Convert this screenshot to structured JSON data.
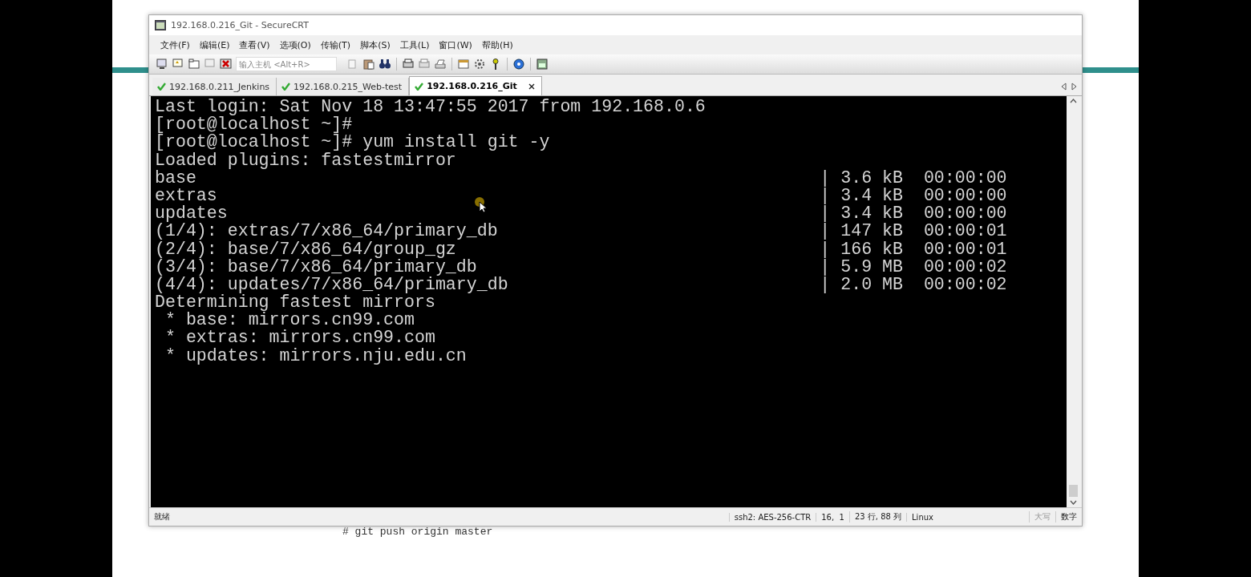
{
  "window": {
    "title": "192.168.0.216_Git - SecureCRT"
  },
  "menu": [
    "文件(F)",
    "编辑(E)",
    "查看(V)",
    "选项(O)",
    "传输(T)",
    "脚本(S)",
    "工具(L)",
    "窗口(W)",
    "帮助(H)"
  ],
  "toolbar": {
    "host_field": {
      "placeholder": "输入主机 <Alt+R>"
    }
  },
  "tabs": [
    {
      "label": "192.168.0.211_Jenkins",
      "selected": false,
      "connected": true
    },
    {
      "label": "192.168.0.215_Web-test",
      "selected": false,
      "connected": true
    },
    {
      "label": "192.168.0.216_Git",
      "selected": true,
      "connected": true
    }
  ],
  "terminal": {
    "lines": [
      {
        "text": "Last login: Sat Nov 18 13:47:55 2017 from 192.168.0.6"
      },
      {
        "text": "[root@localhost ~]#"
      },
      {
        "text": "[root@localhost ~]# yum install git -y"
      },
      {
        "text": "Loaded plugins: fastestmirror"
      },
      {
        "text": "base",
        "progress": "| 3.6 kB  00:00:00"
      },
      {
        "text": "extras",
        "progress": "| 3.4 kB  00:00:00"
      },
      {
        "text": "updates",
        "progress": "| 3.4 kB  00:00:00"
      },
      {
        "text": "(1/4): extras/7/x86_64/primary_db",
        "progress": "| 147 kB  00:00:01"
      },
      {
        "text": "(2/4): base/7/x86_64/group_gz",
        "progress": "| 166 kB  00:00:01"
      },
      {
        "text": "(3/4): base/7/x86_64/primary_db",
        "progress": "| 5.9 MB  00:00:02"
      },
      {
        "text": "(4/4): updates/7/x86_64/primary_db",
        "progress": "| 2.0 MB  00:00:02"
      },
      {
        "text": "Determining fastest mirrors"
      },
      {
        "text": " * base: mirrors.cn99.com"
      },
      {
        "text": " * extras: mirrors.cn99.com"
      },
      {
        "text": " * updates: mirrors.nju.edu.cn"
      }
    ]
  },
  "status_bar": {
    "message": "就绪",
    "items": [
      "ssh2: AES-256-CTR",
      "16,  1",
      "23 行, 88 列",
      "Linux"
    ],
    "indicators": [
      {
        "label": "大写",
        "on": false
      },
      {
        "label": "数字",
        "on": true
      }
    ]
  },
  "slide_text": "# git push origin master"
}
